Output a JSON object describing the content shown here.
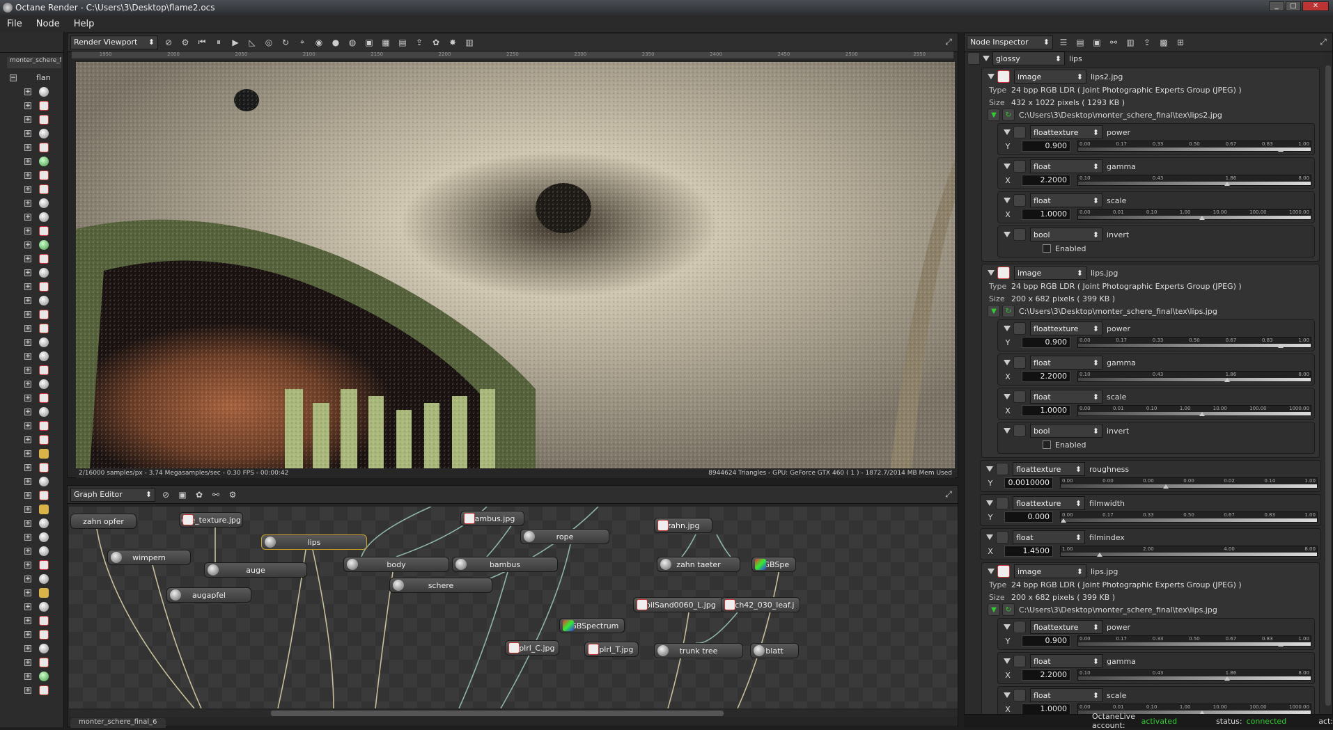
{
  "window": {
    "title": "Octane Render - C:\\Users\\3\\Desktop\\flame2.ocs",
    "min": "_",
    "max": "□",
    "close": "✕"
  },
  "menu": [
    "File",
    "Node",
    "Help"
  ],
  "scene": {
    "tab": "monter_schere_fi",
    "root": "flan"
  },
  "viewport": {
    "mode": "Render Viewport",
    "ruler": [
      "1950",
      "2000",
      "2050",
      "2100",
      "2150",
      "2200",
      "2250",
      "2300",
      "2350",
      "2400",
      "2450",
      "2500",
      "2550"
    ],
    "status_left": "2/16000 samples/px - 3.74 Megasamples/sec - 0.30 FPS - 00:00:42",
    "status_right": "8944624 Triangles - GPU: GeForce GTX 460 ( 1 ) - 1872.7/2014 MB Mem Used"
  },
  "graph": {
    "mode": "Graph Editor",
    "tab": "monter_schere_final_6",
    "nodes": [
      {
        "label": "zahn opfer",
        "icon": "none"
      },
      {
        "label": "eye_texture.jpg",
        "icon": "img"
      },
      {
        "label": "lips",
        "icon": "sph"
      },
      {
        "label": "bambus.jpg",
        "icon": "img"
      },
      {
        "label": "rope",
        "icon": "sph"
      },
      {
        "label": "zahn.jpg",
        "icon": "img"
      },
      {
        "label": "wimpern",
        "icon": "sph"
      },
      {
        "label": "auge",
        "icon": "sph"
      },
      {
        "label": "body",
        "icon": "sph"
      },
      {
        "label": "bambus",
        "icon": "sph"
      },
      {
        "label": "zahn taeter",
        "icon": "sph"
      },
      {
        "label": "RGBSpe",
        "icon": "grad"
      },
      {
        "label": "schere",
        "icon": "sph"
      },
      {
        "label": "augapfel",
        "icon": "sph"
      },
      {
        "label": "SoilSand0060_L.jpg",
        "icon": "img"
      },
      {
        "label": "Arch42_030_leaf.j",
        "icon": "img"
      },
      {
        "label": "RGBSpectrum",
        "icon": "grad"
      },
      {
        "label": "poplrl_C.jpg",
        "icon": "img"
      },
      {
        "label": "poplrl_T.jpg",
        "icon": "img"
      },
      {
        "label": "trunk tree",
        "icon": "sph"
      },
      {
        "label": "blatt",
        "icon": "sph"
      }
    ]
  },
  "inspector": {
    "mode": "Node Inspector",
    "root_type": "glossy",
    "root_name": "lips",
    "images": [
      {
        "type": "image",
        "name": "lips2.jpg",
        "type_val": "24 bpp RGB LDR ( Joint Photographic Experts Group (JPEG) )",
        "size_val": "432 x 1022 pixels ( 1293 KB )",
        "path": "C:\\Users\\3\\Desktop\\monter_schere_final\\tex\\lips2.jpg"
      },
      {
        "type": "image",
        "name": "lips.jpg",
        "type_val": "24 bpp RGB LDR ( Joint Photographic Experts Group (JPEG) )",
        "size_val": "200 x 682 pixels ( 399 KB )",
        "path": "C:\\Users\\3\\Desktop\\monter_schere_final\\tex\\lips.jpg"
      },
      {
        "type": "image",
        "name": "lips.jpg",
        "type_val": "24 bpp RGB LDR ( Joint Photographic Experts Group (JPEG) )",
        "size_val": "200 x 682 pixels ( 399 KB )",
        "path": "C:\\Users\\3\\Desktop\\monter_schere_final\\tex\\lips.jpg"
      }
    ],
    "power": {
      "type": "floattexture",
      "name": "power",
      "key": "Y",
      "value": "0.900",
      "ticks": [
        "0.00",
        "0.17",
        "0.33",
        "0.50",
        "0.67",
        "0.83",
        "1.00"
      ]
    },
    "gamma": {
      "type": "float",
      "name": "gamma",
      "key": "X",
      "value": "2.2000",
      "ticks": [
        "0.10",
        "0.43",
        "1.86",
        "8.00"
      ]
    },
    "scale": {
      "type": "float",
      "name": "scale",
      "key": "X",
      "value": "1.0000",
      "ticks": [
        "0.00",
        "0.01",
        "0.10",
        "1.00",
        "10.00",
        "100.00",
        "1000.00"
      ]
    },
    "invert": {
      "type": "bool",
      "name": "invert",
      "check": "Enabled"
    },
    "roughness": {
      "type": "floattexture",
      "name": "roughness",
      "key": "Y",
      "value": "0.0010000",
      "ticks": [
        "0.00",
        "0.00",
        "0.00",
        "0.00",
        "0.02",
        "0.14",
        "1.00"
      ]
    },
    "filmwidth": {
      "type": "floattexture",
      "name": "filmwidth",
      "key": "Y",
      "value": "0.000",
      "ticks": [
        "0.00",
        "0.17",
        "0.33",
        "0.50",
        "0.67",
        "0.83",
        "1.00"
      ]
    },
    "filmindex": {
      "type": "float",
      "name": "filmindex",
      "key": "X",
      "value": "1.4500",
      "ticks": [
        "1.00",
        "2.00",
        "4.00",
        "8.00"
      ]
    },
    "labels": {
      "type": "Type",
      "size": "Size"
    }
  },
  "status": {
    "account_label": "OctaneLive account:",
    "account_val": "activated",
    "status_label": "status:",
    "status_val": "connected",
    "act": "act:"
  }
}
